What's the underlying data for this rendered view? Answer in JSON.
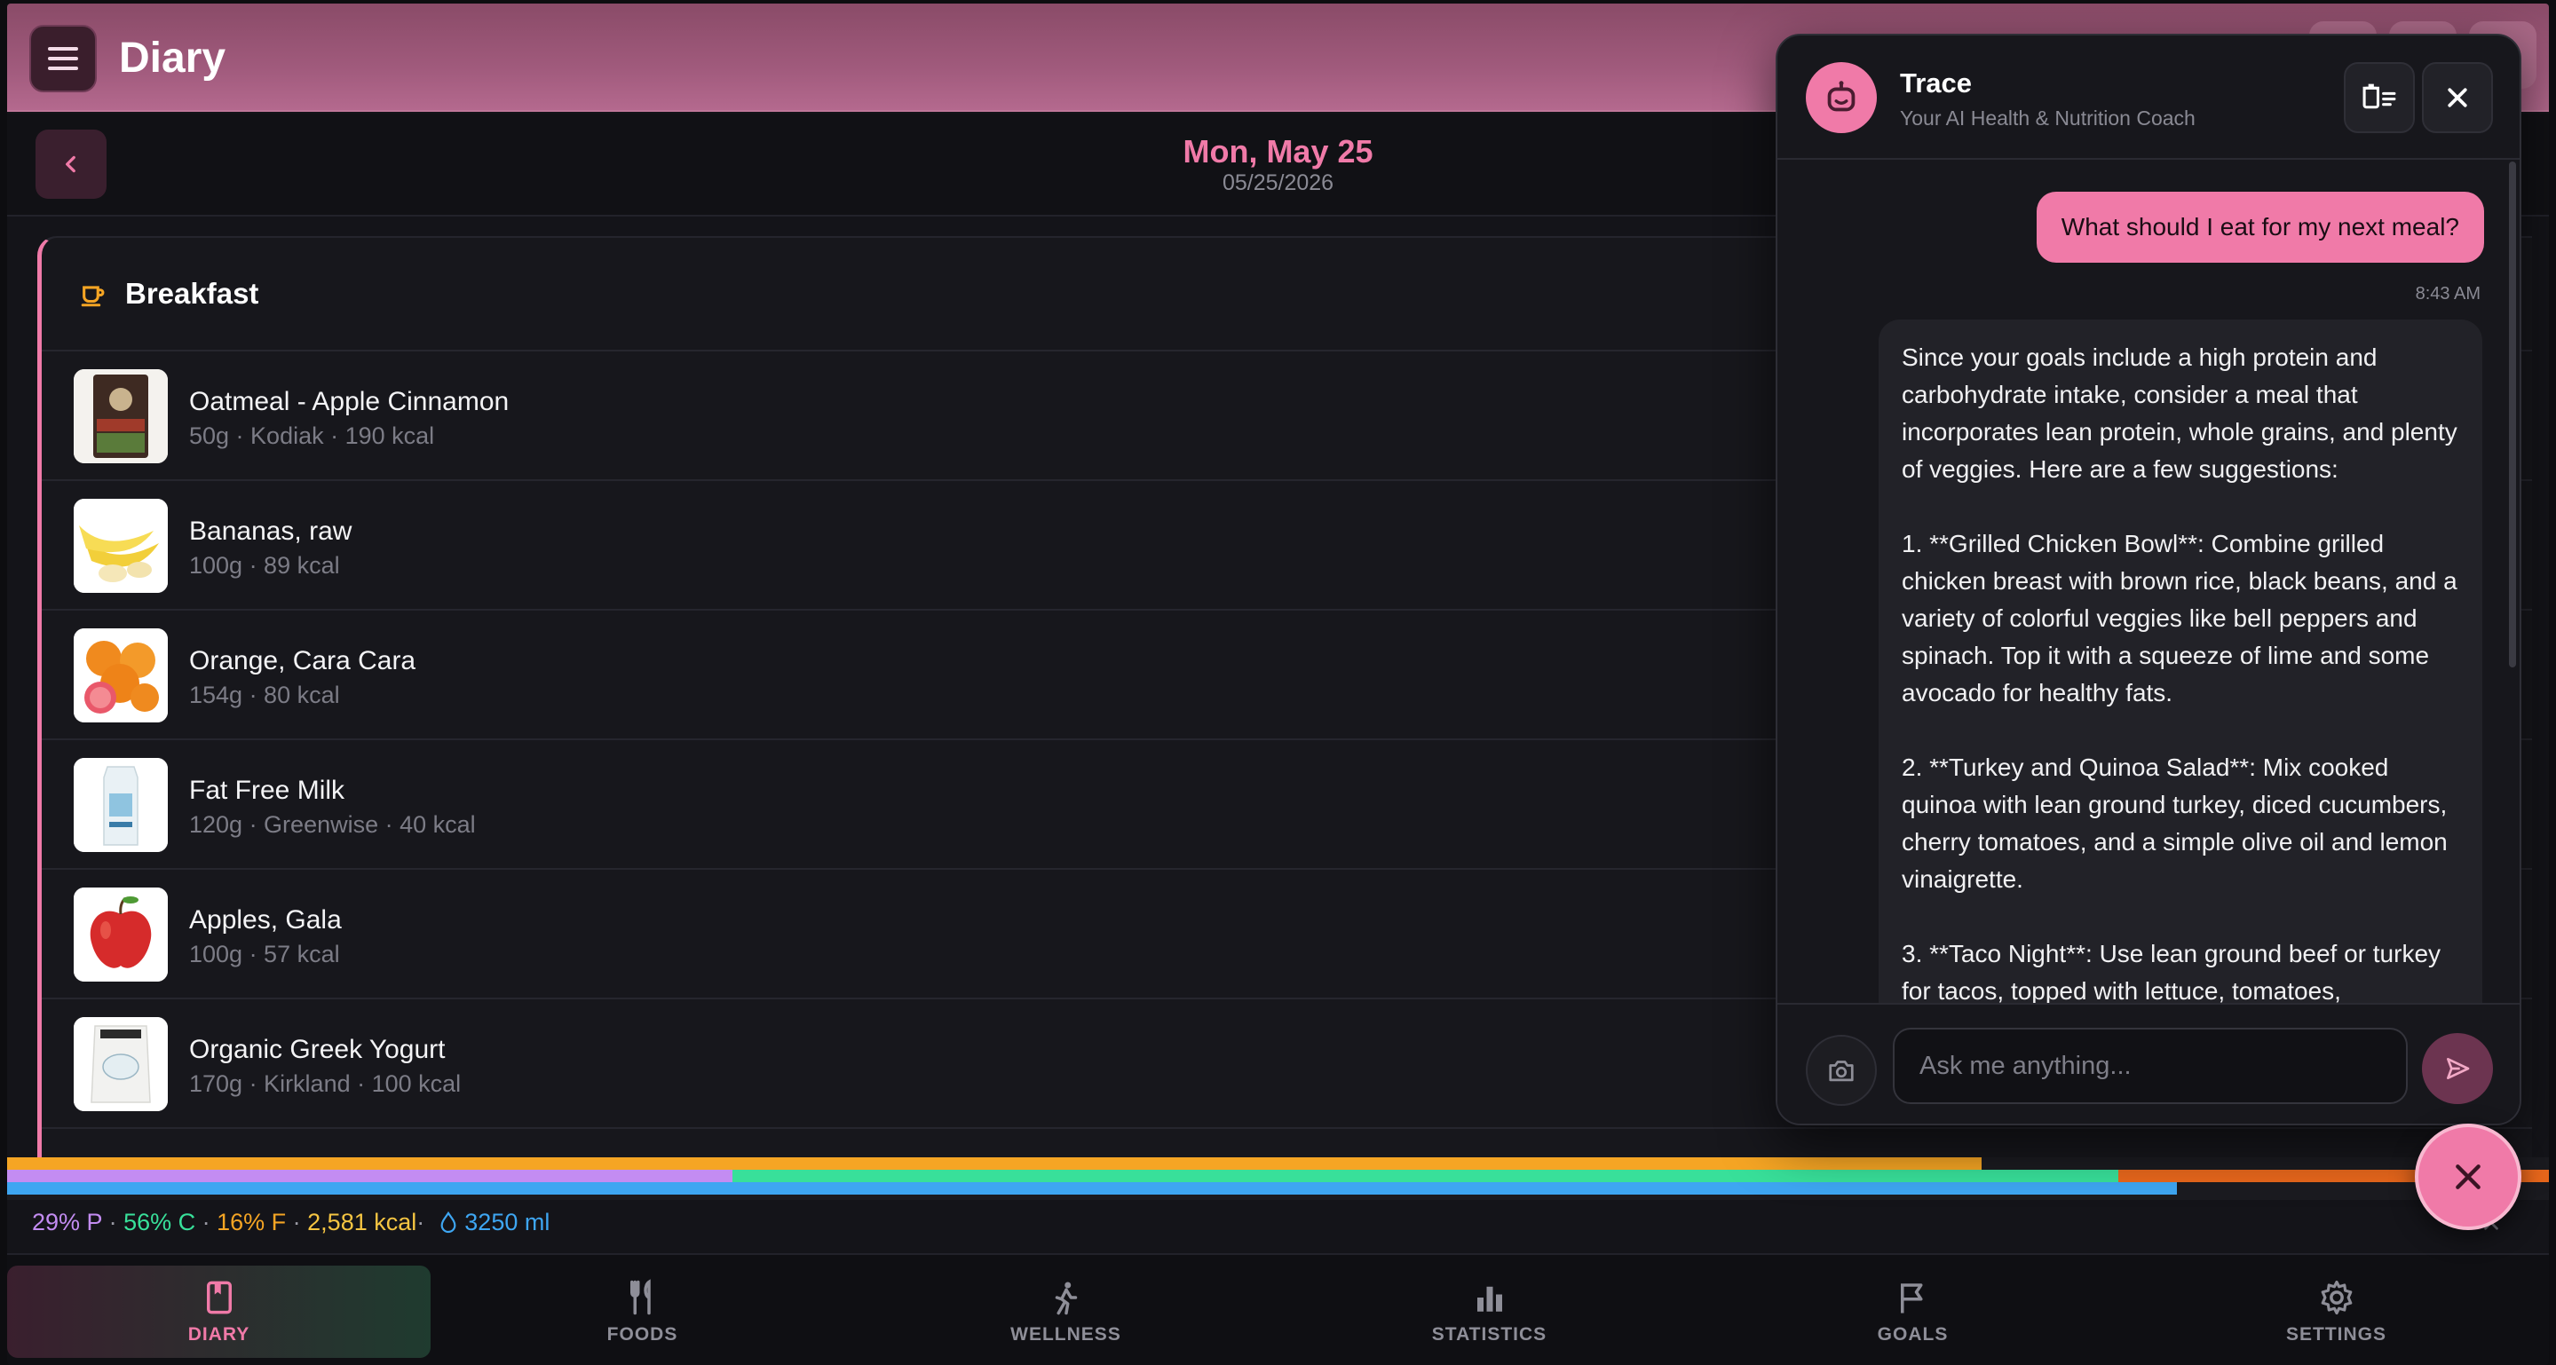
{
  "header": {
    "title": "Diary"
  },
  "datebar": {
    "date": "Mon, May 25",
    "date_numeric": "05/25/2026"
  },
  "meal": {
    "title": "Breakfast",
    "items": [
      {
        "name": "Oatmeal - Apple Cinnamon",
        "meta": "50g · Kodiak · 190 kcal",
        "thumb": "oatmeal-package"
      },
      {
        "name": "Bananas, raw",
        "meta": "100g · 89 kcal",
        "thumb": "bananas"
      },
      {
        "name": "Orange, Cara Cara",
        "meta": "154g · 80 kcal",
        "thumb": "oranges"
      },
      {
        "name": "Fat Free Milk",
        "meta": "120g · Greenwise · 40 kcal",
        "thumb": "milk-carton"
      },
      {
        "name": "Apples, Gala",
        "meta": "100g · 57 kcal",
        "thumb": "apple"
      },
      {
        "name": "Organic Greek Yogurt",
        "meta": "170g · Kirkland · 100 kcal",
        "thumb": "yogurt-bag"
      }
    ]
  },
  "macros": {
    "protein": "29% P",
    "carbs": "56% C",
    "fat": "16% F",
    "kcal": "2,581 kcal",
    "water": "3250 ml",
    "sep": " · ",
    "kcal_sep": "·",
    "progress": {
      "fat_bar": 0.7767,
      "carb_bar_start": 0.2855,
      "carb_bar_end": 0.8305,
      "protein_bar": 0.8538
    },
    "colors": {
      "protein": "#c38cf2",
      "carbs": "#38e09a",
      "fat": "#f5a524",
      "kcal": "#f5c542",
      "water": "#3ea6f2",
      "over": "#e8671c"
    }
  },
  "nav": [
    {
      "label": "DIARY",
      "icon": "bookmark-icon",
      "active": true
    },
    {
      "label": "FOODS",
      "icon": "utensils-icon",
      "active": false
    },
    {
      "label": "WELLNESS",
      "icon": "person-walking-icon",
      "active": false
    },
    {
      "label": "STATISTICS",
      "icon": "bar-chart-icon",
      "active": false
    },
    {
      "label": "GOALS",
      "icon": "flag-icon",
      "active": false
    },
    {
      "label": "SETTINGS",
      "icon": "gear-icon",
      "active": false
    }
  ],
  "chat": {
    "coach_name": "Trace",
    "coach_subtitle": "Your AI Health & Nutrition Coach",
    "user_message": "What should I eat for my next meal?",
    "user_time": "8:43 AM",
    "bot_message": "Since your goals include a high protein and carbohydrate intake, consider a meal that incorporates lean protein, whole grains, and plenty of veggies. Here are a few suggestions:\n\n1. **Grilled Chicken Bowl**: Combine grilled chicken breast with brown rice, black beans, and a variety of colorful veggies like bell peppers and spinach. Top it with a squeeze of lime and some avocado for healthy fats.\n\n2. **Turkey and Quinoa Salad**: Mix cooked quinoa with lean ground turkey, diced cucumbers, cherry tomatoes, and a simple olive oil and lemon vinaigrette.\n\n3. **Taco Night**: Use lean ground beef or turkey for tacos, topped with lettuce, tomatoes,",
    "input_placeholder": "Ask me anything..."
  },
  "theme": {
    "accent": "#f07aa8",
    "header": "#a05a7c",
    "background": "#141419"
  }
}
